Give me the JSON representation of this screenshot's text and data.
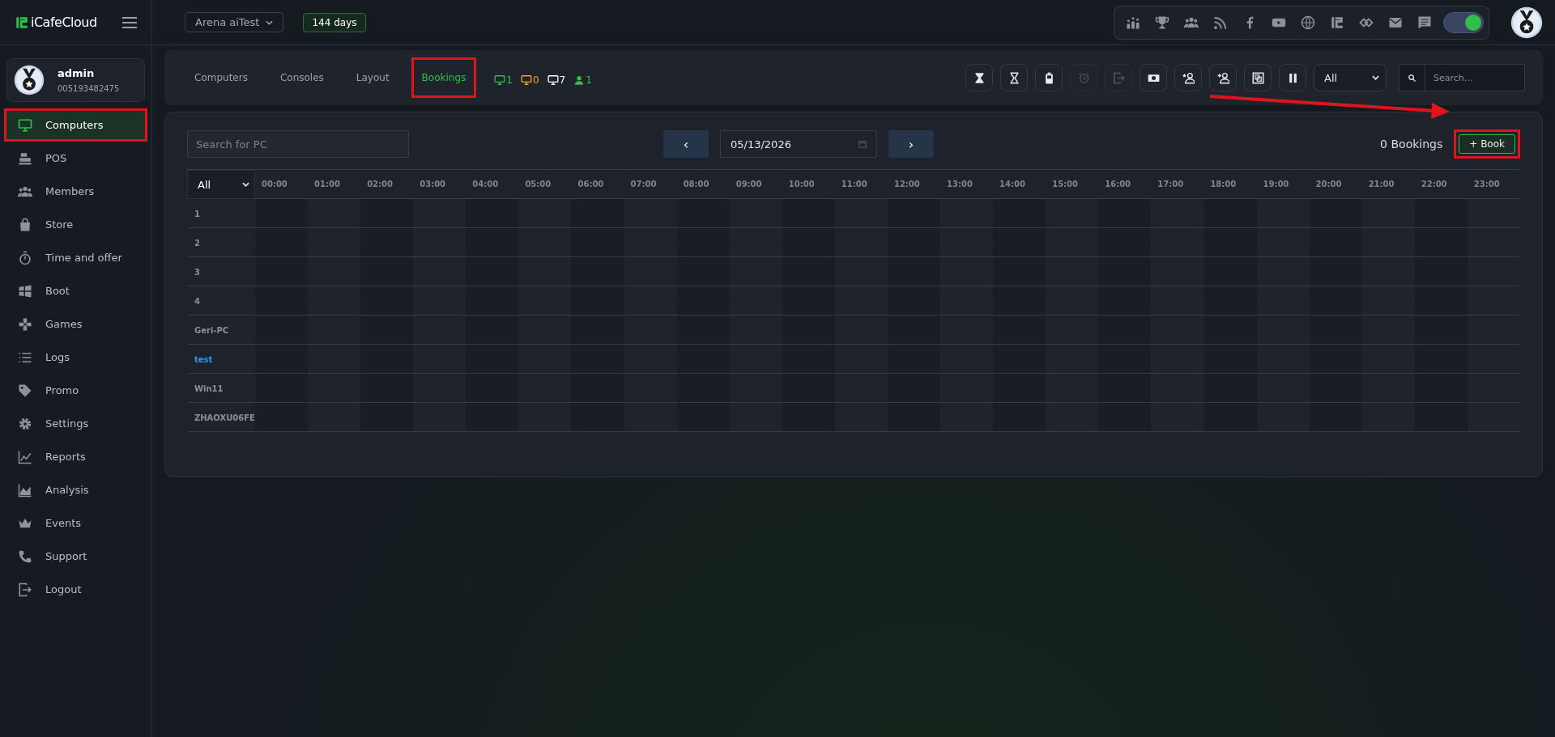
{
  "brand": {
    "name": "iCafeCloud"
  },
  "header": {
    "branch": "Arena aiTest",
    "license": "144 days",
    "toggle_on": true
  },
  "header_icons": [
    {
      "kind": "ranking"
    },
    {
      "kind": "trophy"
    },
    {
      "kind": "group"
    },
    {
      "kind": "rss"
    },
    {
      "kind": "facebook"
    },
    {
      "kind": "youtube"
    },
    {
      "kind": "globe"
    },
    {
      "kind": "logo"
    },
    {
      "kind": "chevrons"
    },
    {
      "kind": "mail"
    },
    {
      "kind": "chat"
    }
  ],
  "profile": {
    "name": "admin",
    "id": "005193482475"
  },
  "sidebar": {
    "items": [
      {
        "label": "Computers",
        "kind": "monitor",
        "selected": true,
        "highlighted": true
      },
      {
        "label": "POS",
        "kind": "register",
        "selected": false,
        "highlighted": false
      },
      {
        "label": "Members",
        "kind": "group",
        "selected": false,
        "highlighted": false
      },
      {
        "label": "Store",
        "kind": "bag",
        "selected": false,
        "highlighted": false
      },
      {
        "label": "Time and offer",
        "kind": "stopwatch",
        "selected": false,
        "highlighted": false
      },
      {
        "label": "Boot",
        "kind": "windows",
        "selected": false,
        "highlighted": false
      },
      {
        "label": "Games",
        "kind": "gamepad",
        "selected": false,
        "highlighted": false
      },
      {
        "label": "Logs",
        "kind": "list",
        "selected": false,
        "highlighted": false
      },
      {
        "label": "Promo",
        "kind": "tag",
        "selected": false,
        "highlighted": false
      },
      {
        "label": "Settings",
        "kind": "gear",
        "selected": false,
        "highlighted": false
      },
      {
        "label": "Reports",
        "kind": "linechart",
        "selected": false,
        "highlighted": false
      },
      {
        "label": "Analysis",
        "kind": "areachart",
        "selected": false,
        "highlighted": false
      },
      {
        "label": "Events",
        "kind": "crown",
        "selected": false,
        "highlighted": false
      },
      {
        "label": "Support",
        "kind": "phone",
        "selected": false,
        "highlighted": false
      },
      {
        "label": "Logout",
        "kind": "logout",
        "selected": false,
        "highlighted": false
      }
    ]
  },
  "tabs": [
    {
      "label": "Computers",
      "selected": false,
      "highlighted": false
    },
    {
      "label": "Consoles",
      "selected": false,
      "highlighted": false
    },
    {
      "label": "Layout",
      "selected": false,
      "highlighted": false
    },
    {
      "label": "Bookings",
      "selected": true,
      "highlighted": true
    }
  ],
  "counters": [
    {
      "kind": "monitor",
      "value": "1",
      "color": "#2fbf4a"
    },
    {
      "kind": "monitor",
      "value": "0",
      "color": "#f5a623"
    },
    {
      "kind": "monitor",
      "value": "7",
      "color": "#ffffff"
    },
    {
      "kind": "person",
      "value": "1",
      "color": "#2fbf4a"
    }
  ],
  "tools": [
    {
      "kind": "hourglass-full",
      "disabled": false
    },
    {
      "kind": "hourglass",
      "disabled": false
    },
    {
      "kind": "battery",
      "disabled": false
    },
    {
      "kind": "alarm",
      "disabled": true
    },
    {
      "kind": "exit",
      "disabled": true
    },
    {
      "kind": "cash",
      "disabled": false
    },
    {
      "kind": "user-star",
      "disabled": false
    },
    {
      "kind": "user-plus",
      "disabled": false
    },
    {
      "kind": "frame",
      "disabled": false
    },
    {
      "kind": "pause",
      "disabled": false
    }
  ],
  "filter": {
    "value": "All"
  },
  "search": {
    "placeholder": "Search..."
  },
  "bookings": {
    "search_placeholder": "Search for PC",
    "prev": "‹",
    "date": "05/13/2026",
    "next": "›",
    "count": "0 Bookings",
    "book_button": {
      "label": "+ Book",
      "highlighted": true,
      "arrow": true
    },
    "group_filter": "All",
    "hours": [
      "00:00",
      "01:00",
      "02:00",
      "03:00",
      "04:00",
      "05:00",
      "06:00",
      "07:00",
      "08:00",
      "09:00",
      "10:00",
      "11:00",
      "12:00",
      "13:00",
      "14:00",
      "15:00",
      "16:00",
      "17:00",
      "18:00",
      "19:00",
      "20:00",
      "21:00",
      "22:00",
      "23:00"
    ],
    "rows": [
      {
        "name": "1",
        "color": "#8a8f98"
      },
      {
        "name": "2",
        "color": "#8a8f98"
      },
      {
        "name": "3",
        "color": "#8a8f98"
      },
      {
        "name": "4",
        "color": "#8a8f98"
      },
      {
        "name": "Geri-PC",
        "color": "#8a8f98"
      },
      {
        "name": "test",
        "color": "#1e9bff"
      },
      {
        "name": "Win11",
        "color": "#8a8f98"
      },
      {
        "name": "ZHAOXU06FE",
        "color": "#8a8f98"
      }
    ]
  }
}
